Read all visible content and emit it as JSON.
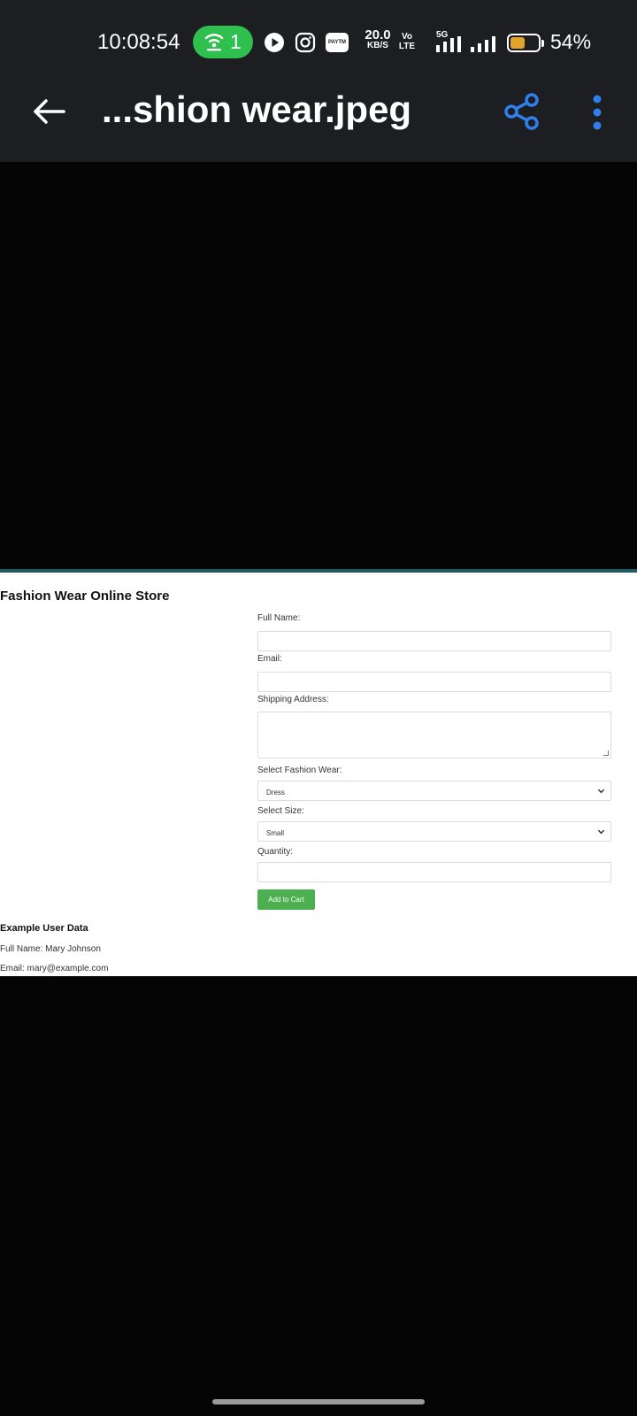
{
  "status_bar": {
    "time": "10:08:54",
    "hotspot_count": "1",
    "paytm_label": "PAYTM",
    "net_speed_value": "20.0",
    "net_speed_unit": "KB/S",
    "volte_top": "Vo",
    "volte_bottom": "LTE",
    "network": "5G",
    "battery_percent": "54%",
    "battery_level": 0.54,
    "colors": {
      "hotspot": "#2fbf4f",
      "battery": "#e1a52b"
    }
  },
  "app_bar": {
    "title": "...shion wear.jpeg",
    "icons": [
      "back-arrow-icon",
      "share-icon",
      "more-vert-icon"
    ],
    "accent": "#2f80ed"
  },
  "page": {
    "store_title": "Fashion Wear Online Store",
    "form": {
      "full_name_label": "Full Name:",
      "full_name_value": "",
      "email_label": "Email:",
      "email_value": "",
      "address_label": "Shipping Address:",
      "address_value": "",
      "fashion_label": "Select Fashion Wear:",
      "fashion_selected": "Dress",
      "size_label": "Select Size:",
      "size_selected": "Small",
      "quantity_label": "Quantity:",
      "quantity_value": "",
      "add_button": "Add to Cart",
      "button_color": "#4caf50"
    },
    "example": {
      "title": "Example User Data",
      "full_name": "Full Name: Mary Johnson",
      "email": "Email: mary@example.com"
    }
  }
}
